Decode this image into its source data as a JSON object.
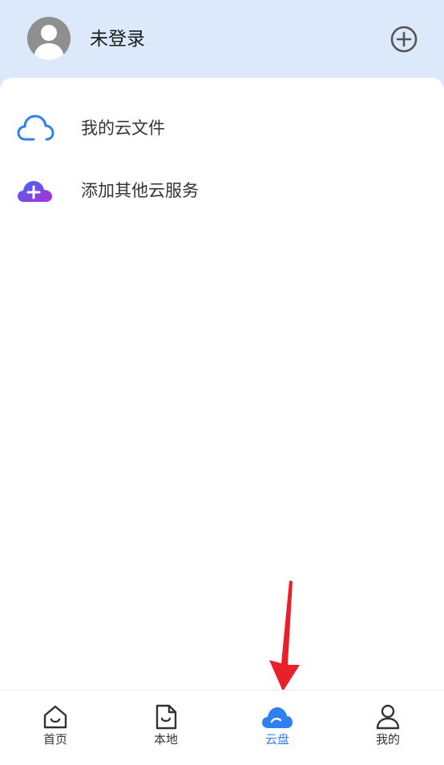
{
  "header": {
    "username": "未登录",
    "avatar_icon": "user-avatar-icon",
    "add_icon": "plus-circle-icon"
  },
  "list": [
    {
      "label": "我的云文件",
      "icon": "cloud-outline-icon"
    },
    {
      "label": "添加其他云服务",
      "icon": "cloud-plus-icon"
    }
  ],
  "tabs": [
    {
      "label": "首页",
      "icon": "home-icon",
      "active": false
    },
    {
      "label": "本地",
      "icon": "file-icon",
      "active": false
    },
    {
      "label": "云盘",
      "icon": "cloud-icon",
      "active": true
    },
    {
      "label": "我的",
      "icon": "person-icon",
      "active": false
    }
  ],
  "colors": {
    "header_bg": "#dbe9fb",
    "accent": "#2f7ff0",
    "arrow": "#e8202a"
  }
}
